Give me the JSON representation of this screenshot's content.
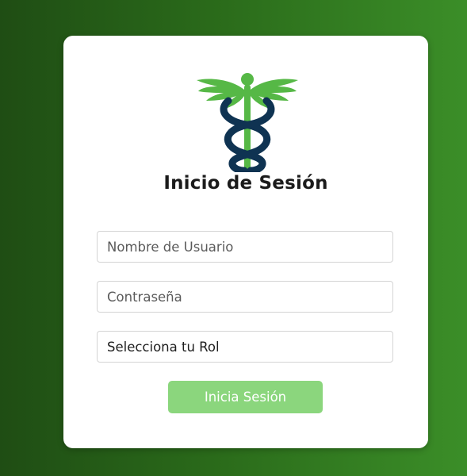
{
  "login": {
    "title": "Inicio de Sesión",
    "username_placeholder": "Nombre de Usuario",
    "password_placeholder": "Contraseña",
    "role_selected": "Selecciona tu Rol",
    "submit_label": "Inicia Sesión"
  },
  "logo": {
    "icon": "caduceus-icon"
  },
  "colors": {
    "background_start": "#1f4d14",
    "background_end": "#3b8e28",
    "card": "#ffffff",
    "button": "#8bd67d",
    "logo_green": "#56b846",
    "logo_navy": "#0f3352"
  }
}
